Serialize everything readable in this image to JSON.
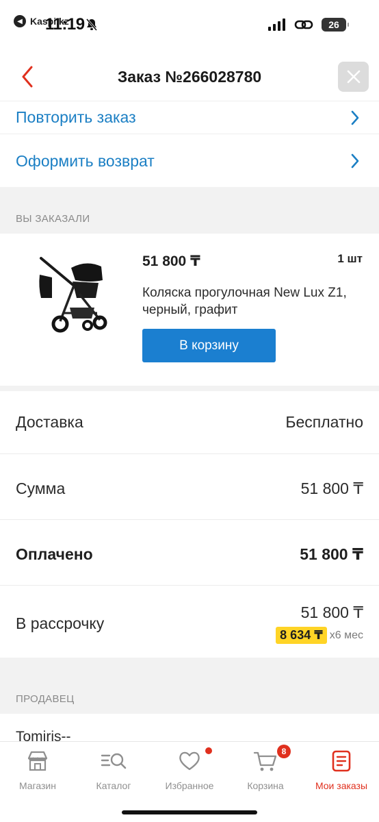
{
  "status_bar": {
    "back_app_label": "Kaspi.kz",
    "time": "11:19",
    "battery": "26"
  },
  "header": {
    "title": "Заказ №266028780"
  },
  "actions": {
    "repeat_label": "Повторить заказ",
    "return_label": "Оформить возврат"
  },
  "ordered": {
    "section_title": "ВЫ ЗАКАЗАЛИ",
    "item": {
      "price": "51 800 ₸",
      "quantity": "1 шт",
      "name": "Коляска прогулочная New Lux Z1, черный, графит",
      "add_to_cart_label": "В корзину"
    }
  },
  "summary": {
    "delivery_label": "Доставка",
    "delivery_value": "Бесплатно",
    "sum_label": "Сумма",
    "sum_value": "51 800 ₸",
    "paid_label": "Оплачено",
    "paid_value": "51 800 ₸",
    "installment_label": "В рассрочку",
    "installment_value": "51 800 ₸",
    "installment_monthly": "8 634 ₸",
    "installment_months": "х6 мес"
  },
  "seller": {
    "section_title": "ПРОДАВЕЦ",
    "name": "Tomiris--"
  },
  "bottom_nav": {
    "items": [
      {
        "label": "Магазин",
        "icon": "shop-icon"
      },
      {
        "label": "Каталог",
        "icon": "catalog-search-icon"
      },
      {
        "label": "Избранное",
        "icon": "heart-icon"
      },
      {
        "label": "Корзина",
        "icon": "cart-icon",
        "badge": "8"
      },
      {
        "label": "Мои заказы",
        "icon": "orders-icon"
      }
    ],
    "active_index": 4
  },
  "colors": {
    "accent_blue": "#1b7fc4",
    "button_blue": "#1b7fd0",
    "active_red": "#e0301e",
    "installment_yellow": "#ffd426"
  }
}
